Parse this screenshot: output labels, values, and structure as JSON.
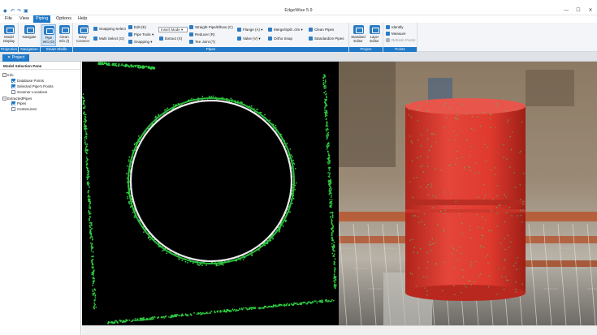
{
  "app": {
    "title": "EdgeWise 5.9",
    "window_controls": {
      "minimize": "—",
      "maximize": "☐",
      "close": "✕"
    }
  },
  "menu": [
    "File",
    "View",
    "Piping",
    "Options",
    "Help"
  ],
  "ribbon": {
    "groups": {
      "projection": {
        "label": "Projection",
        "buttons": [
          {
            "label": "Model Display"
          }
        ]
      },
      "navigation": {
        "label": "Navigation",
        "buttons": [
          {
            "label": "Navigate"
          }
        ]
      },
      "smart_shells": {
        "label": "Smart Shells",
        "buttons": [
          {
            "label": "Pipe Info (O)"
          },
          {
            "label": "Clean Info (I)"
          }
        ]
      },
      "pipes": {
        "label": "Pipes",
        "easy_connect": "Easy Connect",
        "col1": [
          "Snapping Select",
          "Multi Select (G)"
        ],
        "col2": [
          "Edit (E)",
          "Pipe Tools",
          "Snapping"
        ],
        "insert_mode": "Insert Mode",
        "extract": "Extract (X)",
        "col3": [
          "Straight Pipe/Elbow (C)",
          "Reducer (R)",
          "Tee Joint (T)"
        ],
        "col4": [
          "Flange (A)",
          "Valve (V)"
        ],
        "col5": [
          "Merge/Split .clm",
          "Ortho Snap"
        ],
        "col6": [
          "Clean Pipes",
          "Standardize Pipes"
        ]
      },
      "project": {
        "label": "Project",
        "buttons": [
          {
            "label": "Standard Editor"
          },
          {
            "label": "Layer Editor"
          }
        ]
      },
      "points": {
        "label": "Points",
        "items": [
          "Identify",
          "Measure",
          "Refresh Points"
        ]
      }
    }
  },
  "doc_tab": "Project",
  "model_pane": {
    "title": "Model Selection Pane",
    "tree": [
      {
        "label": "Info",
        "level": 0,
        "type": "expander",
        "expand": "−"
      },
      {
        "label": "Database Points",
        "level": 1,
        "checked": true
      },
      {
        "label": "Selected Pipe's Points",
        "level": 1,
        "checked": true
      },
      {
        "label": "Scanner Locations",
        "level": 1,
        "checked": false
      },
      {
        "label": "ExtractedPipes",
        "level": 0,
        "type": "expander",
        "expand": "−"
      },
      {
        "label": "Pipes",
        "level": 1,
        "checked": true
      },
      {
        "label": "CenterLines",
        "level": 1,
        "checked": false
      }
    ]
  },
  "colors": {
    "accent": "#1f78c8",
    "pointcloud_green": "#2ecc40",
    "fit_circle": "#e8e8e8",
    "pipe_red": "#e0392b"
  }
}
